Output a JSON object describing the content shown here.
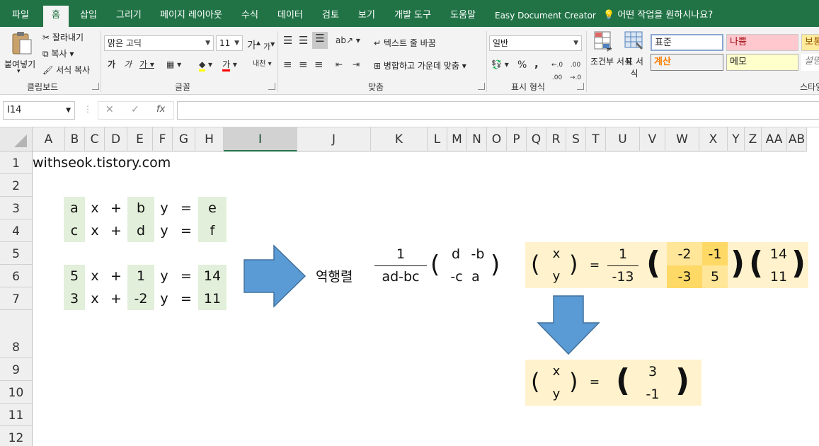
{
  "ribbon_tabs": [
    "파일",
    "홈",
    "삽입",
    "그리기",
    "페이지 레이아웃",
    "수식",
    "데이터",
    "검토",
    "보기",
    "개발 도구",
    "도움말",
    "Easy Document Creator"
  ],
  "active_tab": "홈",
  "tell_me": "어떤 작업을 원하시나요?",
  "clipboard": {
    "paste": "붙여넣기",
    "cut": "잘라내기",
    "copy": "복사",
    "format_painter": "서식 복사",
    "label": "클립보드"
  },
  "font": {
    "name": "맑은 고딕",
    "size": "11",
    "grow": "가",
    "shrink": "가",
    "bold": "가",
    "italic": "가",
    "underline": "가",
    "font_color_glyph": "가",
    "phonetic": "내천",
    "label": "글꼴"
  },
  "alignment": {
    "wrap_text": "텍스트 줄 바꿈",
    "merge_center": "병합하고 가운데 맞춤",
    "label": "맞춤"
  },
  "number": {
    "format": "일반",
    "percent": "%",
    "comma": ",",
    "label": "표시 형식"
  },
  "styles": {
    "conditional": "조건부 서식",
    "table": "표 서식",
    "normal": "표준",
    "bad": "나쁨",
    "good": "보통",
    "calc": "계산",
    "note": "메모",
    "explain": "설명",
    "label": "스타일"
  },
  "colors": {
    "excel_green": "#217346",
    "bad_bg": "#ffc7ce",
    "bad_fg": "#9c0006",
    "calc_fg": "#fa7d00",
    "note_bg": "#ffffcc",
    "good_bg": "#ffeb9c",
    "cell_green": "#e2efda",
    "cell_yellow": "#fff2cc",
    "cell_yellow2": "#ffe699",
    "cell_yellow3": "#ffd966",
    "arrow_blue": "#5b9bd5"
  },
  "name_box": "I14",
  "formula_buttons": {
    "cancel": "✕",
    "enter": "✓",
    "fx": "fx"
  },
  "columns": [
    "A",
    "B",
    "C",
    "D",
    "E",
    "F",
    "G",
    "H",
    "I",
    "J",
    "K",
    "L",
    "M",
    "N",
    "O",
    "P",
    "Q",
    "R",
    "S",
    "T",
    "U",
    "V",
    "W",
    "X",
    "Y",
    "Z",
    "AA",
    "AB"
  ],
  "rows": [
    "1",
    "2",
    "3",
    "4",
    "5",
    "6",
    "7",
    "8",
    "9",
    "10",
    "11",
    "12"
  ],
  "selected_column": "I",
  "sheet": {
    "a1": "withseok.tistory.com",
    "eq1": [
      "a",
      "x",
      "+",
      "b",
      "y",
      "=",
      "e"
    ],
    "eq2": [
      "c",
      "x",
      "+",
      "d",
      "y",
      "=",
      "f"
    ],
    "eq3": [
      "5",
      "x",
      "+",
      "1",
      "y",
      "=",
      "14"
    ],
    "eq4": [
      "3",
      "x",
      "+",
      "-2",
      "y",
      "=",
      "11"
    ],
    "inverse_label": "역행렬",
    "formula": {
      "num": "1",
      "den": "ad-bc",
      "m11": "d",
      "m12": "-b",
      "m21": "-c",
      "m22": "a"
    },
    "calc": {
      "x": "x",
      "y": "y",
      "eq": "=",
      "num": "1",
      "den": "-13",
      "m11": "-2",
      "m12": "-1",
      "m21": "-3",
      "m22": "5",
      "v1": "14",
      "v2": "11"
    },
    "result": {
      "x": "x",
      "y": "y",
      "eq": "=",
      "r1": "3",
      "r2": "-1"
    }
  }
}
